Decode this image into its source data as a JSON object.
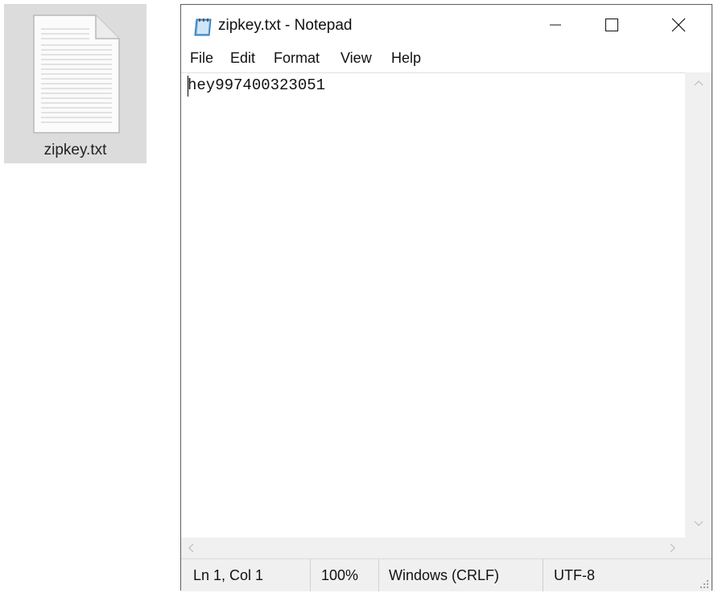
{
  "desktop": {
    "file_name": "zipkey.txt",
    "file_icon": "text-file-icon"
  },
  "window": {
    "title": "zipkey.txt - Notepad",
    "app_icon": "notepad-icon",
    "controls": {
      "minimize_icon": "minimize-icon",
      "maximize_icon": "maximize-icon",
      "close_icon": "close-icon"
    }
  },
  "menu": {
    "items": [
      "File",
      "Edit",
      "Format",
      "View",
      "Help"
    ]
  },
  "editor": {
    "content": "hey997400323051"
  },
  "status": {
    "position": "Ln 1, Col 1",
    "zoom": "100%",
    "line_ending": "Windows (CRLF)",
    "encoding": "UTF-8"
  },
  "colors": {
    "window_border": "#5e5e5e",
    "statusbar_bg": "#f0f0f0",
    "desktop_selection": "#dcdcdc"
  }
}
